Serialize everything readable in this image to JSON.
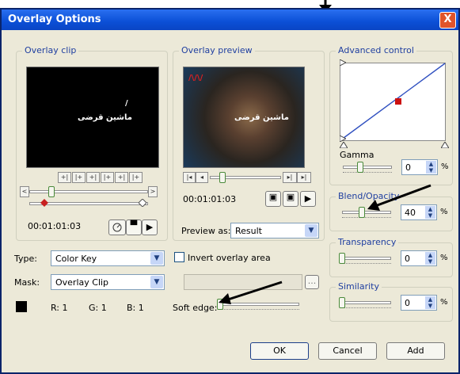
{
  "window": {
    "title": "Overlay Options",
    "close_label": "X"
  },
  "overlay_clip": {
    "title": "Overlay clip",
    "timecode": "00:01:01:03",
    "overlay_text": "ماشین قرضی"
  },
  "overlay_preview": {
    "title": "Overlay preview",
    "timecode": "00:01:01:03",
    "overlay_text": "ماشین قرضی",
    "preview_as_label": "Preview as:",
    "preview_as_value": "Result"
  },
  "advanced_control": {
    "title": "Advanced control",
    "gamma_label": "Gamma",
    "gamma_value": "0",
    "gamma_unit": "%",
    "gamma_level": 0.3
  },
  "blend_opacity": {
    "label": "Blend/Opacity",
    "value": "40",
    "unit": "%",
    "level": 0.4
  },
  "transparency": {
    "label": "Transparency",
    "value": "0",
    "unit": "%",
    "level": 0
  },
  "similarity": {
    "label": "Similarity",
    "value": "0",
    "unit": "%",
    "level": 0
  },
  "type": {
    "label": "Type:",
    "value": "Color Key"
  },
  "invert": {
    "label": "Invert overlay area",
    "checked": false
  },
  "mask": {
    "label": "Mask:",
    "value": "Overlay Clip",
    "more_label": "..."
  },
  "color": {
    "swatch": "#000000",
    "r": "R: 1",
    "g": "G: 1",
    "b": "B: 1"
  },
  "soft_edge": {
    "label": "Soft edge:",
    "level": 0
  },
  "buttons": {
    "ok": "OK",
    "cancel": "Cancel",
    "add": "Add"
  }
}
